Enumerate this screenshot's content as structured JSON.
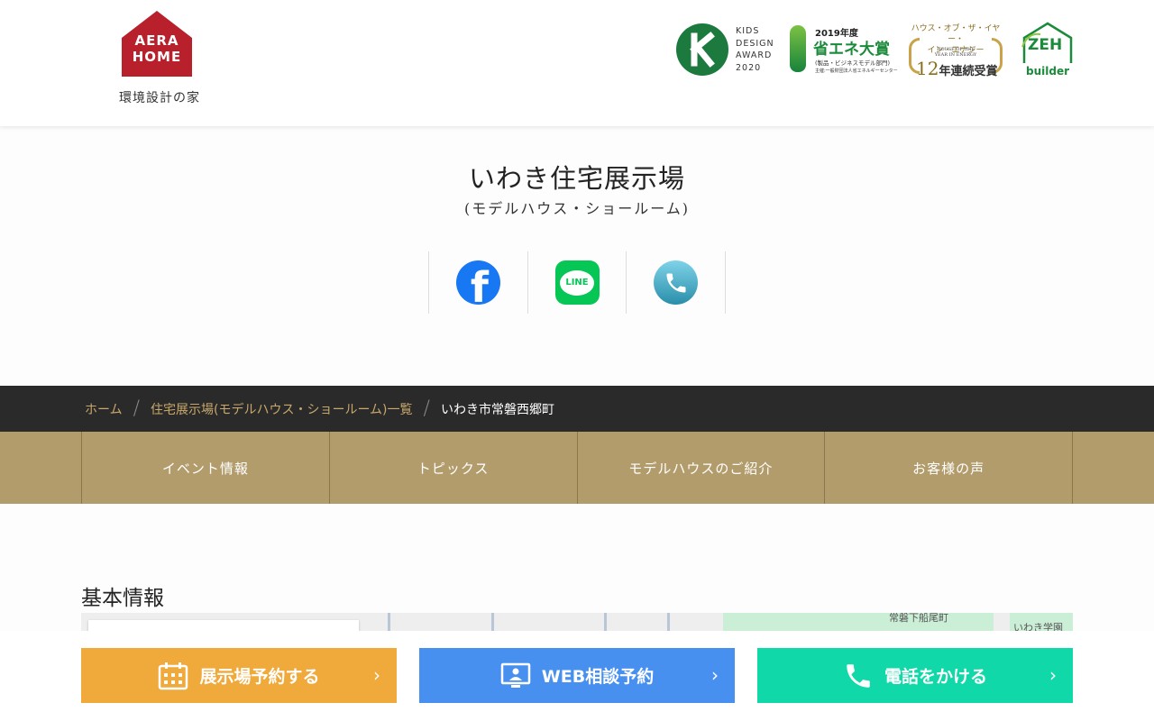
{
  "header": {
    "logo_line1": "AERA",
    "logo_line2": "HOME",
    "logo_tagline": "環境設計の家",
    "awards": {
      "kids": {
        "lines": [
          "KIDS",
          "DESIGN",
          "AWARD",
          "2020"
        ]
      },
      "shoene": {
        "year": "2019年度",
        "name": "省エネ大賞",
        "category": "(製品・ビジネスモデル部門)",
        "org": "主催:一般財団法人省エネルギーセンター"
      },
      "hoy": {
        "title1": "ハウス・オブ・ザ・イヤー・",
        "title2": "イン・エナジー",
        "en": "HOUSE OF THE YEAR IN ENERGY",
        "count": "12",
        "suffix": "年連続受賞"
      },
      "zeh": {
        "mark": "ZEH",
        "label": "builder"
      }
    }
  },
  "page": {
    "title": "いわき住宅展示場",
    "subtitle": "(モデルハウス・ショールーム)"
  },
  "social": [
    {
      "name": "facebook-icon"
    },
    {
      "name": "line-icon",
      "label": "LINE"
    },
    {
      "name": "phone-icon"
    }
  ],
  "breadcrumb": {
    "home": "ホーム",
    "list": "住宅展示場(モデルハウス・ショールーム)一覧",
    "current": "いわき市常磐西郷町",
    "separator": "/"
  },
  "subnav": [
    "イベント情報",
    "トピックス",
    "モデルハウスのご紹介",
    "お客様の声"
  ],
  "section": {
    "title": "基本情報",
    "map_labels": [
      "常磐下船尾町",
      "いわき学園"
    ]
  },
  "cta": {
    "reserve": "展示場予約する",
    "web": "WEB相談予約",
    "tel": "電話をかける",
    "chevron": "›"
  },
  "colors": {
    "brand_red": "#b8202c",
    "gold": "#b39c6c",
    "cta_orange": "#f0a93b",
    "cta_blue": "#4790f0",
    "cta_green": "#10d8a8"
  }
}
